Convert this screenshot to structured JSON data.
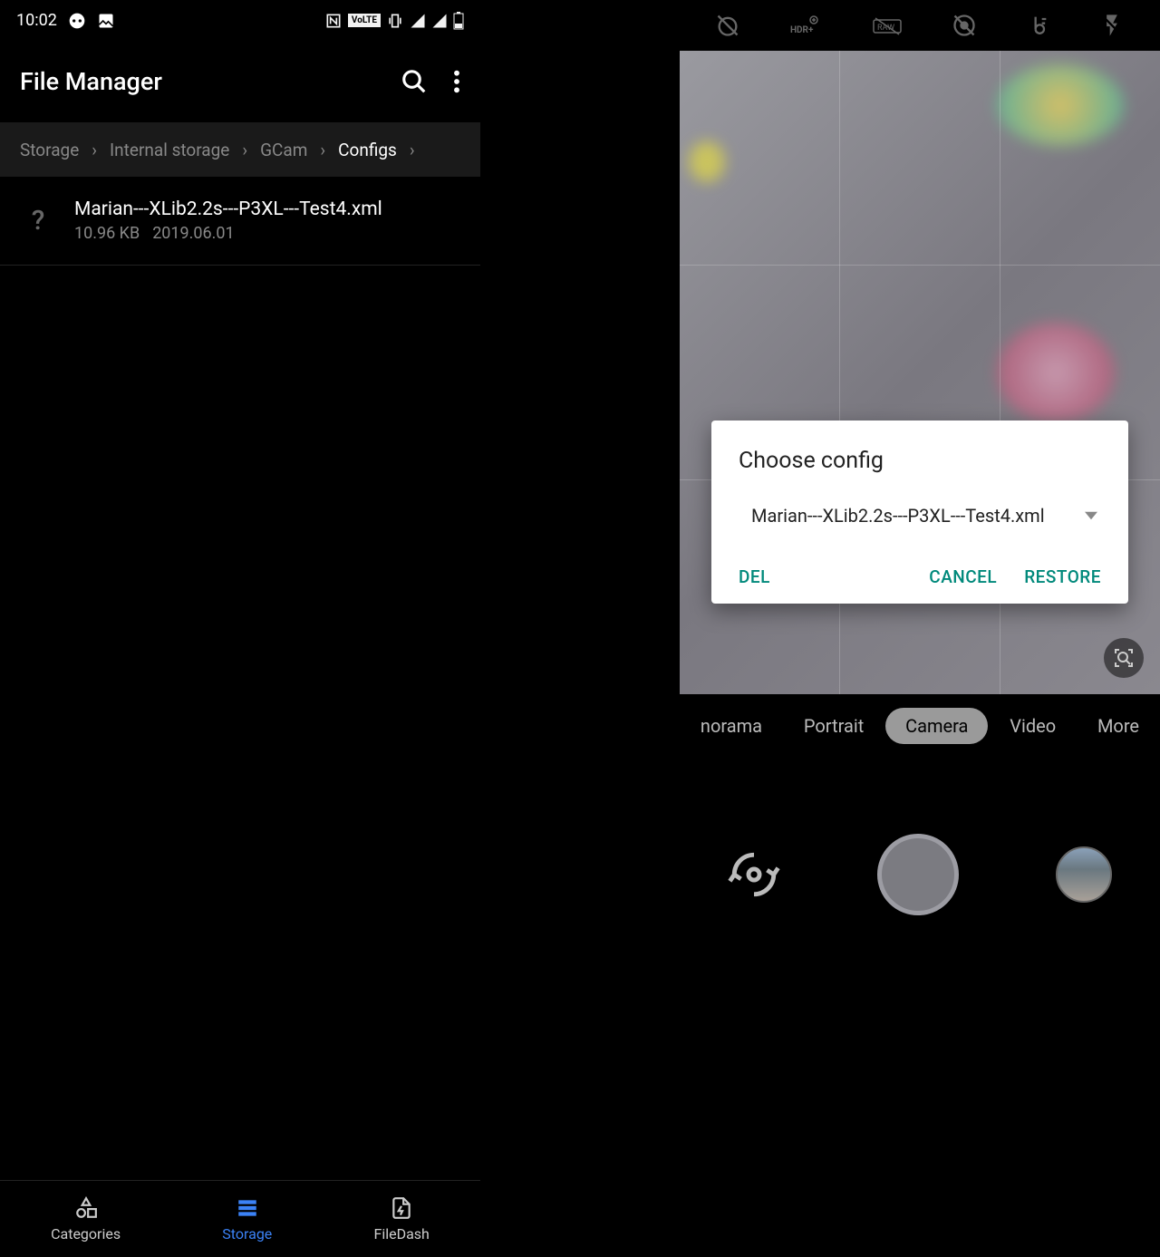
{
  "status": {
    "time": "10:02"
  },
  "file_manager": {
    "title": "File Manager",
    "breadcrumb": [
      "Storage",
      "Internal storage",
      "GCam",
      "Configs"
    ],
    "file": {
      "name": "Marian---XLib2.2s---P3XL---Test4.xml",
      "size": "10.96 KB",
      "date": "2019.06.01"
    },
    "nav": {
      "categories": "Categories",
      "storage": "Storage",
      "filedash": "FileDash"
    }
  },
  "camera": {
    "modes": {
      "panorama": "norama",
      "portrait": "Portrait",
      "camera": "Camera",
      "video": "Video",
      "more": "More"
    },
    "dialog": {
      "title": "Choose config",
      "selected": "Marian---XLib2.2s---P3XL---Test4.xml",
      "del": "DEL",
      "cancel": "CANCEL",
      "restore": "RESTORE"
    }
  },
  "colors": {
    "accent": "#00897b",
    "active_nav": "#3b82f6"
  }
}
